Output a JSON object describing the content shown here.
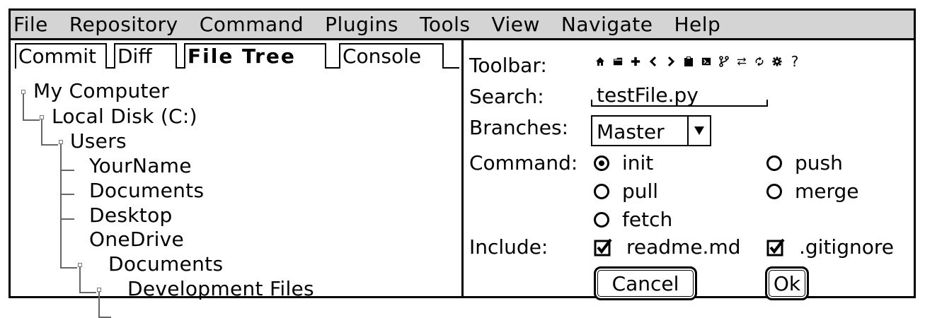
{
  "menu": [
    "File",
    "Repository",
    "Command",
    "Plugins",
    "Tools",
    "View",
    "Navigate",
    "Help"
  ],
  "tabs": {
    "commit": "Commit",
    "diff": "Diff",
    "file_tree": "File Tree",
    "console": "Console",
    "active": "File Tree"
  },
  "tree": {
    "my_computer": "My Computer",
    "local_disk": "Local Disk (C:)",
    "users": "Users",
    "your_name": "YourName",
    "documents": "Documents",
    "desktop": "Desktop",
    "one_drive": "OneDrive",
    "onedrive_documents": "Documents",
    "dev_files": "Development Files"
  },
  "form": {
    "toolbar_label": "Toolbar:",
    "toolbar_icons": [
      "home-icon",
      "folder-icon",
      "plus-icon",
      "chevron-left-icon",
      "chevron-right-icon",
      "clipboard-icon",
      "terminal-icon",
      "branch-icon",
      "swap-icon",
      "refresh-icon",
      "gear-icon",
      "help-icon"
    ],
    "help_glyph": "?",
    "search_label": "Search:",
    "search_value": "testFile.py",
    "branches_label": "Branches:",
    "branch_value": "Master",
    "command_label": "Command:",
    "commands": {
      "init": "init",
      "push": "push",
      "pull": "pull",
      "merge": "merge",
      "fetch": "fetch",
      "selected": "init"
    },
    "include_label": "Include:",
    "include": {
      "readme": "readme.md",
      "gitignore": ".gitignore",
      "readme_checked": true,
      "gitignore_checked": true
    },
    "cancel_label": "Cancel",
    "ok_label": "Ok"
  }
}
